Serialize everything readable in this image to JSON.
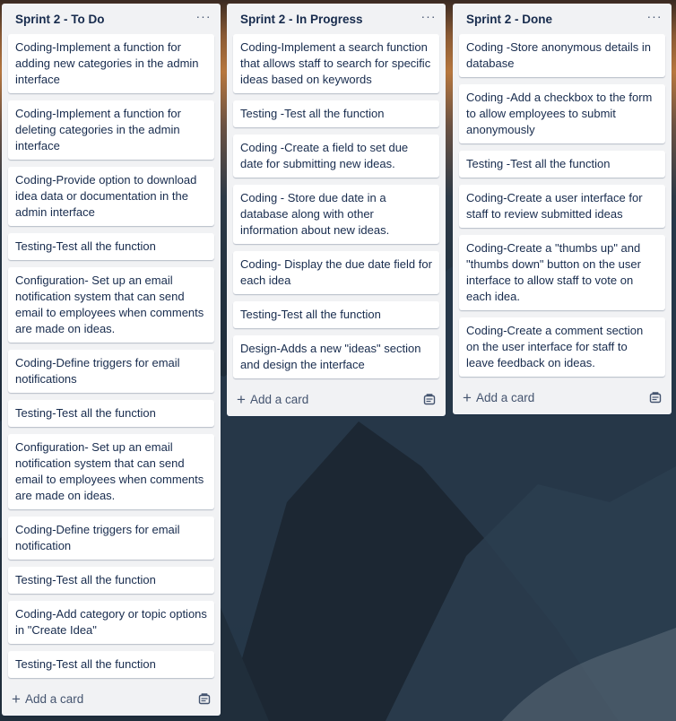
{
  "board": {
    "lists": [
      {
        "title": "Sprint 2 - To Do",
        "menu_icon": "ellipsis-icon",
        "cards": [
          "Coding-Implement a function for adding new categories in the admin interface",
          "Coding-Implement a function for deleting categories in the admin interface",
          "Coding-Provide option to download idea data or documentation in the admin interface",
          "Testing-Test all the function",
          "Configuration- Set up an email notification system that can send email to employees when comments are made on ideas.",
          "Coding-Define triggers for email notifications",
          "Testing-Test all the function",
          "Configuration- Set up an email notification system that can send email to employees when comments are made on ideas.",
          "Coding-Define triggers for email notification",
          "Testing-Test all the function",
          "Coding-Add category or topic options in \"Create Idea\"",
          "Testing-Test all the function"
        ],
        "add_card_label": "Add a card"
      },
      {
        "title": "Sprint 2 - In Progress",
        "menu_icon": "ellipsis-icon",
        "cards": [
          "Coding-Implement a search function that allows staff to search for specific ideas based on keywords",
          "Testing -Test all the function",
          "Coding -Create a field to set due date for submitting new ideas.",
          "Coding - Store due date in a database along with other information about new ideas.",
          "Coding- Display the due date field for each idea",
          "Testing-Test all the function",
          "Design-Adds a new \"ideas\" section and design the interface"
        ],
        "add_card_label": "Add a card"
      },
      {
        "title": "Sprint 2 - Done",
        "menu_icon": "ellipsis-icon",
        "cards": [
          "Coding -Store anonymous details in database",
          "Coding -Add a checkbox to the form to allow employees to submit anonymously",
          "Testing -Test all the function",
          "Coding-Create a user interface for staff to review submitted ideas",
          "Coding-Create a \"thumbs up\" and \"thumbs down\" button on the user interface to allow staff to vote on each idea.",
          "Coding-Create a comment section on the user interface for staff to leave feedback on ideas."
        ],
        "add_card_label": "Add a card"
      }
    ]
  },
  "icons": {
    "plus": "+",
    "menu": "···"
  },
  "colors": {
    "list_bg": "#f1f2f4",
    "card_bg": "#ffffff",
    "text": "#172b4d",
    "muted": "#44546f"
  }
}
